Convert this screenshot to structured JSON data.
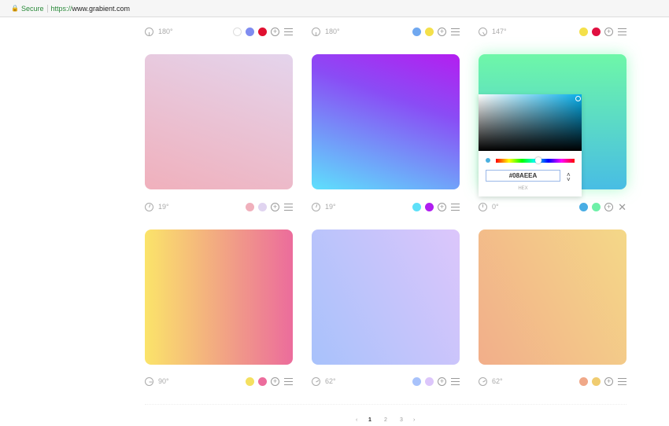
{
  "browser": {
    "secure": "Secure",
    "protocol": "https://",
    "host": "www.grabient.com"
  },
  "top_row": [
    {
      "angle": "180°",
      "colors": [
        "#ffffff",
        "#7f8cf0",
        "#e01030"
      ]
    },
    {
      "angle": "180°",
      "colors": [
        "#70a8f0",
        "#f4e04a"
      ]
    },
    {
      "angle": "147°",
      "colors": [
        "#f4e04a",
        "#e01040"
      ]
    }
  ],
  "cards": [
    {
      "angle": "19°",
      "gradient": "linear-gradient(19deg,#f0b0bc,#e4d4ec)",
      "colors": [
        "#f0b0bc",
        "#e0d4f0"
      ]
    },
    {
      "angle": "19°",
      "gradient": "linear-gradient(19deg,#5ee0fc,#8a4cf5 65%,#b41ef0)",
      "colors": [
        "#5ee0f8",
        "#b01ef0"
      ]
    },
    {
      "angle": "0°",
      "gradient": "linear-gradient(0deg,#48bde4,#6ef7a8)",
      "colors": [
        "#48ade4",
        "#6ef0a8"
      ],
      "editing": true
    },
    {
      "angle": "90°",
      "gradient": "linear-gradient(90deg,#fbe46a,#f2a882 50%,#ec6c9c)",
      "colors": [
        "#f4e060",
        "#ec6c9c"
      ]
    },
    {
      "angle": "62°",
      "gradient": "linear-gradient(62deg,#a8c2fb,#dcc6fb)",
      "colors": [
        "#a8c2fb",
        "#dcc6fb"
      ]
    },
    {
      "angle": "62°",
      "gradient": "linear-gradient(62deg,#f2ae8a,#f4d888)",
      "colors": [
        "#f0a888",
        "#f0cc70"
      ]
    }
  ],
  "picker": {
    "hex_value": "#08AEEA",
    "hex_label": "HEX"
  },
  "pagination": {
    "prev": "‹",
    "pages": [
      "1",
      "2",
      "3"
    ],
    "next": "›"
  }
}
